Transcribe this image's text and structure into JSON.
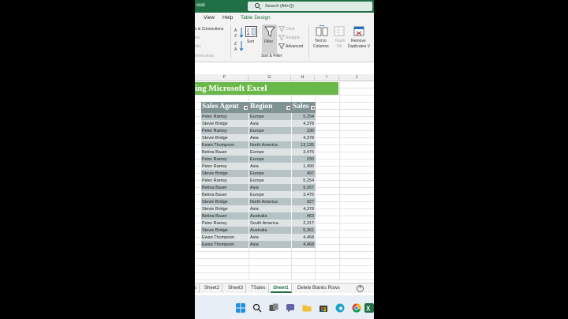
{
  "app": {
    "title": "xcel",
    "search_placeholder": "Search (Alt+Q)"
  },
  "menu": {
    "items": [
      "View",
      "Help",
      "Table Design"
    ]
  },
  "ribbon": {
    "connections": {
      "queries_connections": "s & Connections",
      "properties": "ies",
      "edit_links": "nks",
      "group_label": "onnections"
    },
    "sort_filter": {
      "sort": "Sort",
      "filter": "Filter",
      "clear": "Clear",
      "reapply": "Reapply",
      "advanced": "Advanced",
      "group_label": "Sort & Filter"
    },
    "data_tools": {
      "text_to_columns_1": "Text to",
      "text_to_columns_2": "Columns",
      "flash_fill_1": "Flash",
      "flash_fill_2": "Fill",
      "remove_dup_1": "Remove",
      "remove_dup_2": "Duplicates V"
    }
  },
  "columns": [
    "F",
    "G",
    "H",
    "I",
    "J"
  ],
  "banner": "ing Microsoft Excel",
  "table": {
    "headers": [
      "Sales Agent",
      "Region",
      "Sales"
    ],
    "rows": [
      [
        "Peter Ramsy",
        "Europe",
        "5,254"
      ],
      [
        "Stevie Bridge",
        "Asia",
        "4,378"
      ],
      [
        "Peter Ramsy",
        "Europe",
        "230"
      ],
      [
        "Stevie Bridge",
        "Asia",
        "4,378"
      ],
      [
        "Ewan Thompson",
        "North America",
        "13,135"
      ],
      [
        "Betina Bauer",
        "Europe",
        "3,476"
      ],
      [
        "Peter Ramsy",
        "Europe",
        "230"
      ],
      [
        "Peter Ramsy",
        "Asia",
        "1,490"
      ],
      [
        "Stevie Bridge",
        "Europe",
        "497"
      ],
      [
        "Peter Ramsy",
        "Europe",
        "5,254"
      ],
      [
        "Betina Bauer",
        "Asia",
        "9,267"
      ],
      [
        "Betina Bauer",
        "Europe",
        "3,476"
      ],
      [
        "Stevie Bridge",
        "North America",
        "927"
      ],
      [
        "Stevie Bridge",
        "Asia",
        "4,378"
      ],
      [
        "Betina Bauer",
        "Australia",
        "463"
      ],
      [
        "Peter Ramsy",
        "South America",
        "2,317"
      ],
      [
        "Stevie Bridge",
        "Australia",
        "5,361"
      ],
      [
        "Ewan Thompson",
        "Asia",
        "4,468"
      ],
      [
        "Ewan Thompson",
        "Asia",
        "4,468"
      ]
    ]
  },
  "sheet_tabs": {
    "items": [
      "s",
      "Sheet2",
      "Sheet3",
      "TSales",
      "Sheet1",
      "Delete Blanks Rows"
    ],
    "active": "Sheet1"
  },
  "colors": {
    "excel_green": "#1f7145",
    "banner_green": "#6ab84a",
    "table_header": "#7f9294",
    "band_dark": "#b6c2c4",
    "band_light": "#dee3e4"
  }
}
